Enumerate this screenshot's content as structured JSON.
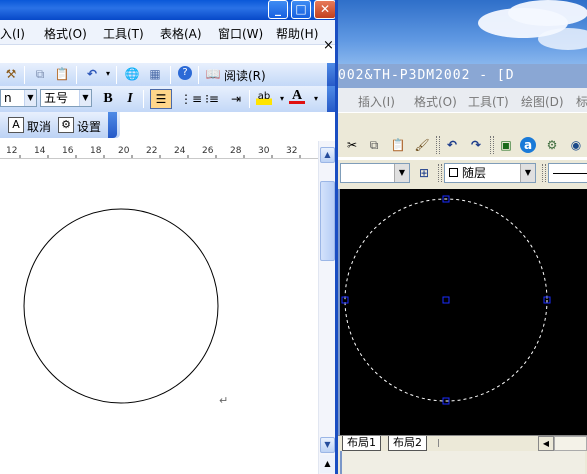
{
  "word": {
    "window_buttons": {
      "minimize": "_",
      "maximize": "□",
      "close": "✕"
    },
    "menu": [
      {
        "label": "入(I)"
      },
      {
        "label": "格式(O)"
      },
      {
        "label": "工具(T)"
      },
      {
        "label": "表格(A)"
      },
      {
        "label": "窗口(W)"
      },
      {
        "label": "帮助(H)"
      }
    ],
    "menu_close": "×",
    "toolbar": {
      "read_label": "阅读(R)",
      "font_name_value": "n",
      "font_size_value": "五号",
      "bold_label": "B",
      "italic_label": "I",
      "cancel_label": "取消",
      "settings_label": "设置",
      "cancel_glyph": "A"
    },
    "ruler_ticks": [
      "12",
      "14",
      "16",
      "18",
      "20",
      "22",
      "24",
      "26",
      "28",
      "30",
      "32"
    ],
    "paragraph_mark": "↵",
    "accent_color": "#0a58d8"
  },
  "cad": {
    "title": "002&TH-P3DM2002 - [D",
    "menu": [
      {
        "label": "插入(I)"
      },
      {
        "label": "格式(O)"
      },
      {
        "label": "工具(T)"
      },
      {
        "label": "绘图(D)"
      },
      {
        "label": "标"
      }
    ],
    "layer_value": "随层",
    "layout_tabs": [
      {
        "label": "布局1"
      },
      {
        "label": "布局2"
      }
    ],
    "canvas_color": "#000000",
    "grip_color": "#1a2cff"
  }
}
